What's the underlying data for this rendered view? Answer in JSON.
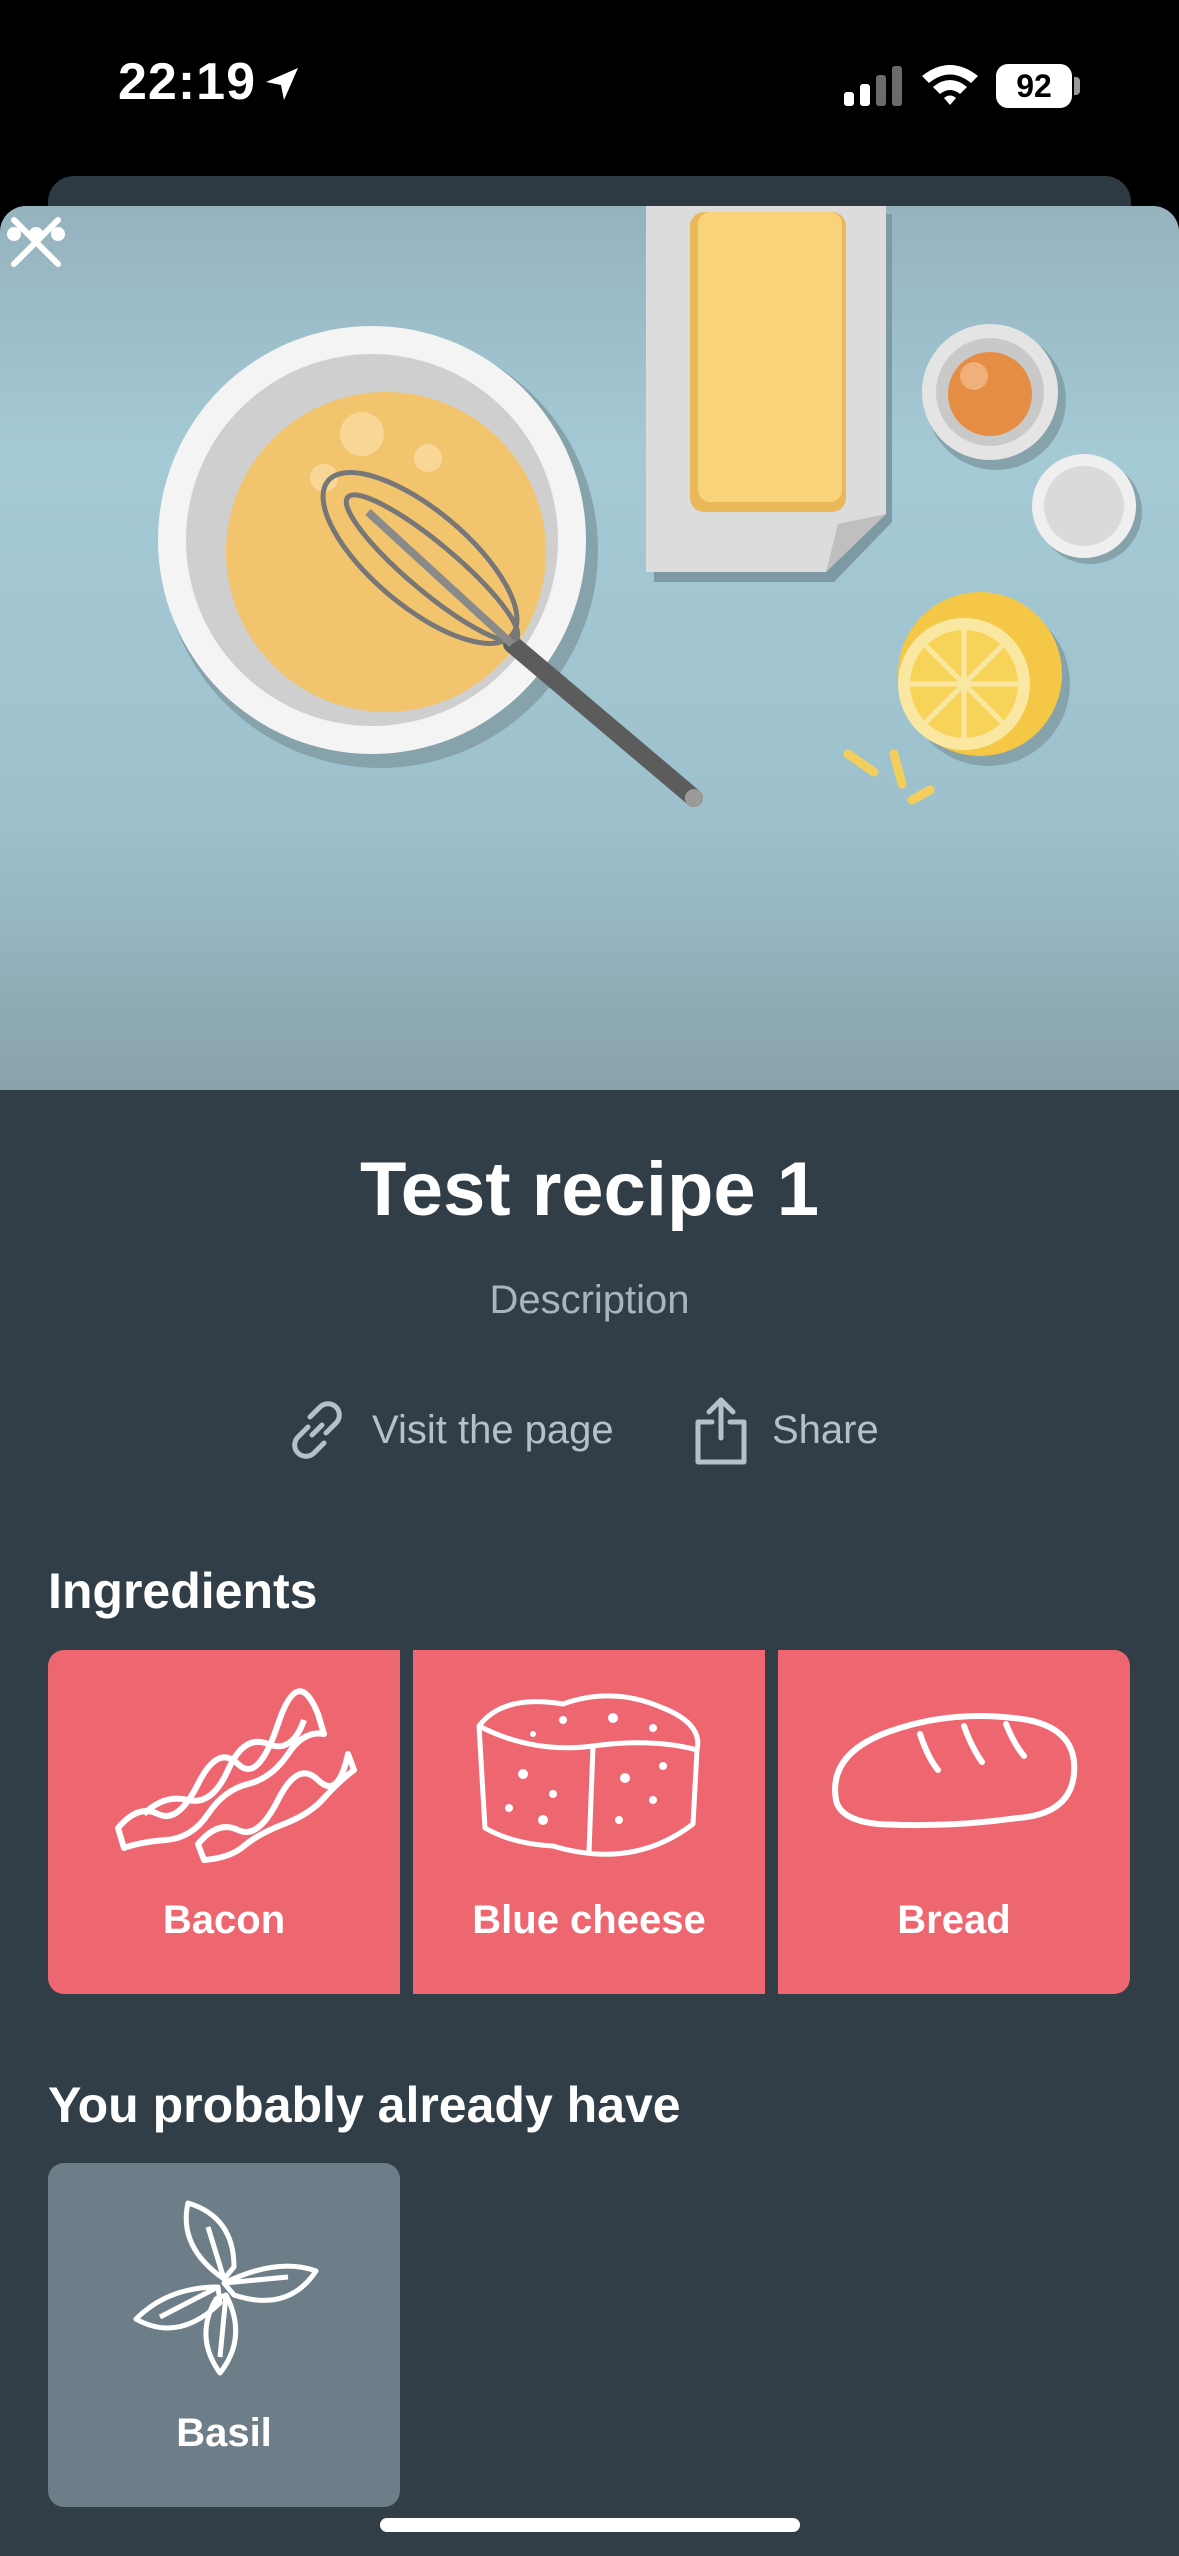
{
  "status_bar": {
    "time": "22:19",
    "battery_level": "92"
  },
  "recipe": {
    "title": "Test recipe 1",
    "description": "Description"
  },
  "actions": {
    "visit_label": "Visit the page",
    "share_label": "Share"
  },
  "ingredients": {
    "heading": "Ingredients",
    "items": [
      {
        "label": "Bacon",
        "icon": "bacon-icon"
      },
      {
        "label": "Blue cheese",
        "icon": "cheese-icon"
      },
      {
        "label": "Bread",
        "icon": "bread-icon"
      }
    ]
  },
  "pantry": {
    "heading": "You probably already have",
    "items": [
      {
        "label": "Basil",
        "icon": "basil-icon"
      }
    ]
  },
  "colors": {
    "sheet_background": "#313d47",
    "ingredient_tile": "#ee6670",
    "pantry_tile": "#6e7e89",
    "hero_background": "#a4cad6"
  }
}
